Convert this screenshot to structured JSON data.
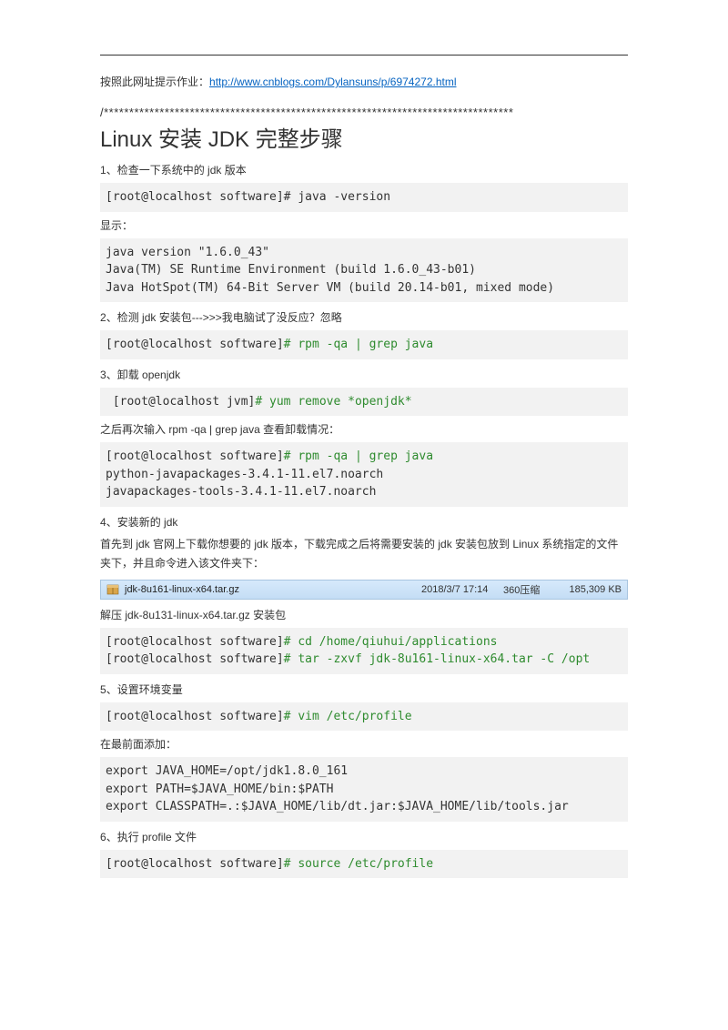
{
  "intro": {
    "prefix": "按照此网址提示作业：",
    "url": "http://www.cnblogs.com/Dylansuns/p/6974272.html"
  },
  "stars": "/*********************************************************************************",
  "title": "Linux 安装 JDK 完整步骤",
  "s1": {
    "label_a": "1",
    "label_b": "、检查一下系统中的 ",
    "label_c": "jdk",
    "label_d": " 版本",
    "code": "[root@localhost software]# java -version",
    "show": "显示：",
    "out": "java version \"1.6.0_43\"\nJava(TM) SE Runtime Environment (build 1.6.0_43-b01)\nJava HotSpot(TM) 64-Bit Server VM (build 20.14-b01, mixed mode)"
  },
  "s2": {
    "label_a": "2",
    "label_b": "、检测 ",
    "label_c": "jdk",
    "label_d": " 安装包--->>>我电脑试了没反应？忽略",
    "prompt": "[root@localhost software]",
    "cmd": "# rpm -qa | grep java"
  },
  "s3": {
    "label_a": "3",
    "label_b": "、卸载 ",
    "label_c": "openjdk",
    "prompt": " [root@localhost jvm]",
    "cmd": "# yum remove *openjdk*",
    "after_a": "之后再次输入 ",
    "after_b": "rpm -qa | grep java",
    "after_c": " 查看卸载情况：",
    "out_prompt": "[root@localhost software]",
    "out_cmd": "# rpm -qa | grep java",
    "out_rest": "python-javapackages-3.4.1-11.el7.noarch\njavapackages-tools-3.4.1-11.el7.noarch"
  },
  "s4": {
    "label_a": "4",
    "label_b": "、安装新的 ",
    "label_c": "jdk",
    "desc_a": "首先到 ",
    "desc_b": "jdk",
    "desc_c": " 官网上下载你想要的 ",
    "desc_d": "jdk",
    "desc_e": " 版本，下载完成之后将需要安装的 ",
    "desc_f": "jdk",
    "desc_g": " 安装包放到 ",
    "desc_h": "Linux",
    "desc_i": " 系统指定的文件夹下，并且命令进入该文件夹下：",
    "file": {
      "name": "jdk-8u161-linux-x64.tar.gz",
      "date": "2018/3/7 17:14",
      "type": "360压缩",
      "size": "185,309 KB"
    },
    "unzip_a": "解压 ",
    "unzip_b": "jdk-8u131-linux-x64.tar.gz",
    "unzip_c": " 安装包",
    "p1": "[root@localhost software]",
    "c1": "# cd /home/qiuhui/applications",
    "p2": "[root@localhost software]",
    "c2": "# tar -zxvf jdk-8u161-linux-x64.tar -C /opt"
  },
  "s5": {
    "label_a": "5",
    "label_b": "、设置环境变量",
    "prompt": "[root@localhost software]",
    "cmd": "# vim /etc/profile",
    "add": "在最前面添加：",
    "env": "export JAVA_HOME=/opt/jdk1.8.0_161\nexport PATH=$JAVA_HOME/bin:$PATH\nexport CLASSPATH=.:$JAVA_HOME/lib/dt.jar:$JAVA_HOME/lib/tools.jar"
  },
  "s6": {
    "label_a": "6",
    "label_b": "、执行 ",
    "label_c": "profile",
    "label_d": " 文件",
    "prompt": "[root@localhost software]",
    "cmd": "# source /etc/profile"
  }
}
